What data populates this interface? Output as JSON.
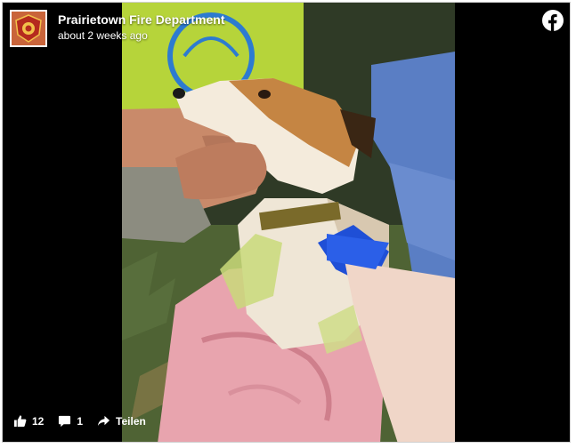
{
  "post": {
    "page_name": "Prairietown Fire Department",
    "timestamp": "about 2 weeks ago"
  },
  "actions": {
    "likes": "12",
    "comments": "1",
    "share_label": "Teilen"
  },
  "icons": {
    "avatar": "fire-department-badge-icon",
    "brand": "facebook-icon",
    "like": "thumbs-up-icon",
    "comment": "comment-bubble-icon",
    "share": "share-arrow-icon"
  },
  "colors": {
    "background": "#000000",
    "text": "#ffffff",
    "avatar_bg": "#c9643a"
  }
}
